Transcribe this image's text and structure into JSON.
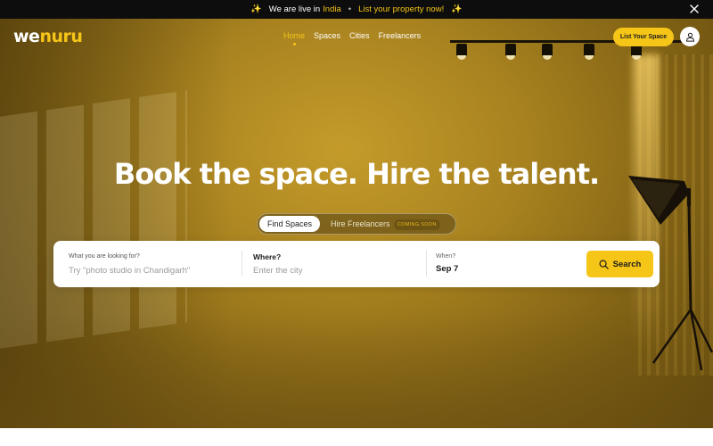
{
  "announcement": {
    "text": "We are live in",
    "highlight": "India",
    "cta": "List your property now!",
    "sparkle": "✨",
    "separator": "•"
  },
  "header": {
    "logo": {
      "part1": "we",
      "part2": "nuru"
    },
    "nav": [
      {
        "label": "Home",
        "active": true
      },
      {
        "label": "Spaces",
        "active": false
      },
      {
        "label": "Cities",
        "active": false
      },
      {
        "label": "Freelancers",
        "active": false
      }
    ],
    "list_button": "List Your Space",
    "user_icon": "user-icon"
  },
  "hero": {
    "headline": "Book the space. Hire the talent.",
    "toggle": {
      "find_label": "Find Spaces",
      "hire_label": "Hire Freelancers",
      "badge": "COMING SOON"
    }
  },
  "search": {
    "what": {
      "label": "What you are looking for?",
      "placeholder": "Try \"photo studio in Chandigarh\""
    },
    "where": {
      "label": "Where?",
      "placeholder": "Enter the city"
    },
    "when": {
      "label": "When?",
      "value": "Sep 7"
    },
    "button": "Search",
    "button_icon": "search-icon"
  },
  "colors": {
    "accent": "#f5c518",
    "bar": "#0d0d0d",
    "hero": "#a8821f"
  }
}
